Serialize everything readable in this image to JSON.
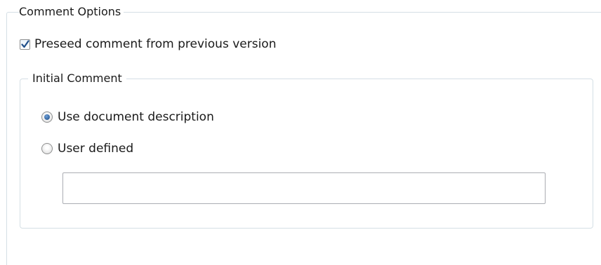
{
  "comment_options": {
    "group_label": "Comment Options",
    "preseed_checkbox": {
      "label": "Preseed comment from previous version",
      "checked": true
    }
  },
  "initial_comment": {
    "group_label": "Initial Comment",
    "options": [
      {
        "label": "Use document description",
        "selected": true
      },
      {
        "label": "User defined",
        "selected": false
      }
    ],
    "user_defined_input": {
      "value": "",
      "placeholder": ""
    }
  },
  "colors": {
    "group_border": "#d5dfe5",
    "check_accent": "#1f4f8a"
  },
  "icons": {
    "checkbox": "checkmark-icon",
    "radio_selected": "radio-dot-icon"
  }
}
